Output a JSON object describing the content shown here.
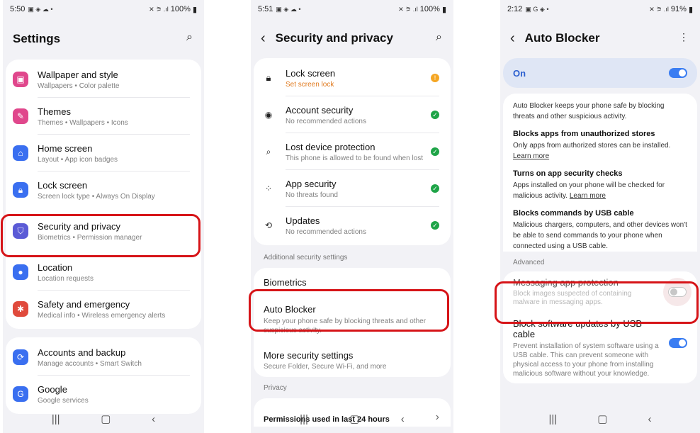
{
  "screen1": {
    "status": {
      "time": "5:50",
      "battery": "100%"
    },
    "title": "Settings",
    "groups": [
      [
        {
          "label": "Wallpaper and style",
          "sub": "Wallpapers  •  Color palette",
          "icon": "wallpaper-icon",
          "color": "#e0478c"
        },
        {
          "label": "Themes",
          "sub": "Themes  •  Wallpapers  •  Icons",
          "icon": "themes-icon",
          "color": "#e0478c"
        },
        {
          "label": "Home screen",
          "sub": "Layout  •  App icon badges",
          "icon": "home-icon",
          "color": "#3a6ff0"
        },
        {
          "label": "Lock screen",
          "sub": "Screen lock type  •  Always On Display",
          "icon": "lock-icon",
          "color": "#3a6ff0"
        },
        {
          "label": "Security and privacy",
          "sub": "Biometrics  •  Permission manager",
          "icon": "shield-icon",
          "color": "#5b5bd6"
        },
        {
          "label": "Location",
          "sub": "Location requests",
          "icon": "location-icon",
          "color": "#3a6ff0"
        },
        {
          "label": "Safety and emergency",
          "sub": "Medical info  •  Wireless emergency alerts",
          "icon": "emergency-icon",
          "color": "#e04a3c"
        }
      ],
      [
        {
          "label": "Accounts and backup",
          "sub": "Manage accounts  •  Smart Switch",
          "icon": "sync-icon",
          "color": "#3a6ff0"
        },
        {
          "label": "Google",
          "sub": "Google services",
          "icon": "google-icon",
          "color": "#3a6ff0"
        }
      ]
    ]
  },
  "screen2": {
    "status": {
      "time": "5:51",
      "battery": "100%"
    },
    "title": "Security and privacy",
    "items": [
      {
        "label": "Lock screen",
        "sub": "Set screen lock",
        "state": "warn"
      },
      {
        "label": "Account security",
        "sub": "No recommended actions",
        "state": "ok"
      },
      {
        "label": "Lost device protection",
        "sub": "This phone is allowed to be found when lost",
        "state": "ok"
      },
      {
        "label": "App security",
        "sub": "No threats found",
        "state": "ok"
      },
      {
        "label": "Updates",
        "sub": "No recommended actions",
        "state": "ok"
      }
    ],
    "section_additional": "Additional security settings",
    "biometrics": "Biometrics",
    "auto_blocker": {
      "label": "Auto Blocker",
      "sub": "Keep your phone safe by blocking threats and other suspicious activity."
    },
    "more": {
      "label": "More security settings",
      "sub": "Secure Folder, Secure Wi-Fi, and more"
    },
    "section_privacy": "Privacy",
    "permissions": "Permissions used in last 24 hours"
  },
  "screen3": {
    "status": {
      "time": "2:12",
      "battery": "91%"
    },
    "title": "Auto Blocker",
    "on_label": "On",
    "intro": "Auto Blocker keeps your phone safe by blocking threats and other suspicious activity.",
    "f1_title": "Blocks apps from unauthorized stores",
    "f1_text": "Only apps from authorized stores can be installed.",
    "learn_more": "Learn more",
    "f2_title": "Turns on app security checks",
    "f2_text": "Apps installed on your phone will be checked for malicious activity.",
    "f3_title": "Blocks commands by USB cable",
    "f3_text": "Malicious chargers, computers, and other devices won't be able to send commands to your phone when connected using a USB cable.",
    "advanced": "Advanced",
    "msg_title": "Messaging app protection",
    "msg_sub": "Block images suspected of containing malware in messaging apps.",
    "usb_title": "Block software updates by USB cable",
    "usb_sub": "Prevent installation of system software using a USB cable. This can prevent someone with physical access to your phone from installing malicious software without your knowledge."
  }
}
